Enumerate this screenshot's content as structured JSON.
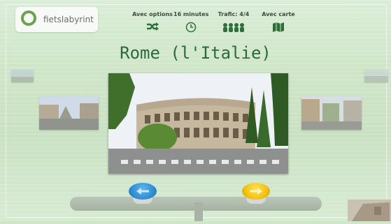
{
  "brand": {
    "name": "fietslabyrint"
  },
  "options": [
    {
      "label": "Avec options",
      "icon": "shuffle-icon"
    },
    {
      "label": "16 minutes",
      "icon": "clock-icon"
    },
    {
      "label": "Trafic: 4/4",
      "icon": "people-icon"
    },
    {
      "label": "Avec carte",
      "icon": "map-icon"
    }
  ],
  "location": {
    "title": "Rome (l'Italie)"
  },
  "colors": {
    "title": "#2b6b3b",
    "accent_green": "#6aa34b",
    "left_button": "#2f8fd5",
    "right_button": "#f2c20f"
  },
  "controls": {
    "left_button_icon": "arrow-left-icon",
    "right_button_icon": "arrow-right-icon"
  }
}
